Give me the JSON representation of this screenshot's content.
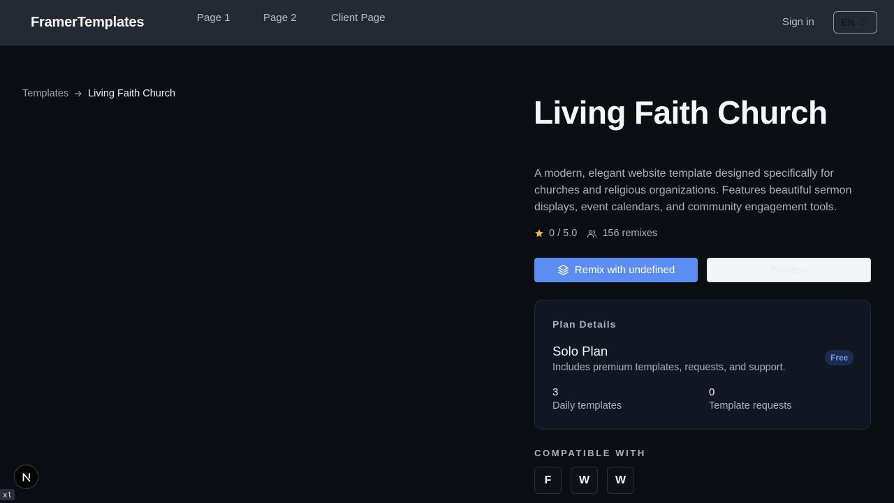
{
  "header": {
    "brand": "FramerTemplates",
    "nav": [
      "Page 1",
      "Page 2",
      "Client Page"
    ],
    "signin": "Sign in",
    "language": "EN"
  },
  "breadcrumb": {
    "parent": "Templates",
    "current": "Living Faith Church"
  },
  "template": {
    "title": "Living Faith Church",
    "description": "A modern, elegant website template designed specifically for churches and religious organizations. Features beautiful sermon displays, event calendars, and community engagement tools.",
    "rating": "0 / 5.0",
    "remixes": "156 remixes",
    "remix_button": "Remix with undefined",
    "preview_button": "Preview"
  },
  "plan": {
    "heading": "Plan Details",
    "name": "Solo Plan",
    "subtitle": "Includes premium templates, requests, and support.",
    "badge": "Free",
    "metrics": [
      {
        "value": "3",
        "label": "Daily templates"
      },
      {
        "value": "0",
        "label": "Template requests"
      }
    ]
  },
  "compatible": {
    "heading": "COMPATIBLE WITH",
    "items": [
      "F",
      "W",
      "W"
    ]
  },
  "dev": {
    "badge_letter": "N",
    "breakpoint": "xl"
  },
  "colors": {
    "background": "#0b0e13",
    "header": "#242a33",
    "accent": "#5b8df2",
    "star": "#f5b642"
  }
}
